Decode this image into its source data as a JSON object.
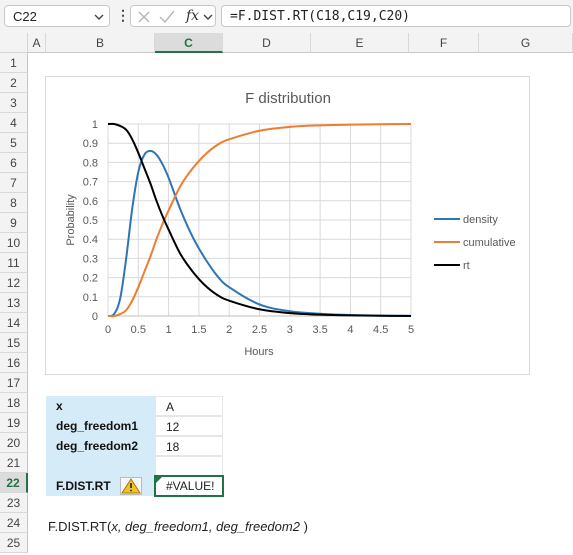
{
  "formula_bar": {
    "name_box": "C22",
    "fx_label": "fx",
    "formula": "=F.DIST.RT(C18,C19,C20)"
  },
  "columns": [
    "A",
    "B",
    "C",
    "D",
    "E",
    "F",
    "G"
  ],
  "rows": [
    "1",
    "2",
    "3",
    "4",
    "5",
    "6",
    "7",
    "8",
    "9",
    "10",
    "11",
    "12",
    "13",
    "14",
    "15",
    "16",
    "17",
    "18",
    "19",
    "20",
    "21",
    "22",
    "23",
    "24",
    "25"
  ],
  "selected_column": "C",
  "selected_row": "22",
  "table": {
    "x_label": "x",
    "x_value": "A",
    "df1_label": "deg_freedom1",
    "df1_value": "12",
    "df2_label": "deg_freedom2",
    "df2_value": "18",
    "result_label": "F.DIST.RT",
    "result_value": "#VALUE!"
  },
  "syntax": {
    "func": "F.DIST.RT(",
    "args": "x, deg_freedom1, deg_freedom2",
    "close": " )"
  },
  "colors": {
    "density": "#2E75B6",
    "cumulative": "#ED7D31",
    "rt": "#000000",
    "accent": "#217346",
    "label_fill": "#D6EBF8"
  },
  "chart_data": {
    "type": "line",
    "title": "F distribution",
    "xlabel": "Hours",
    "ylabel": "Probability",
    "xlim": [
      0,
      5
    ],
    "ylim": [
      0,
      1
    ],
    "x_ticks": [
      "0",
      "0.5",
      "1",
      "1.5",
      "2",
      "2.5",
      "3",
      "3.5",
      "4",
      "4.5",
      "5"
    ],
    "y_ticks": [
      "0",
      "0.1",
      "0.2",
      "0.3",
      "0.4",
      "0.5",
      "0.6",
      "0.7",
      "0.8",
      "0.9",
      "1"
    ],
    "grid": true,
    "legend_position": "right",
    "x": [
      0,
      0.1,
      0.2,
      0.3,
      0.4,
      0.5,
      0.6,
      0.7,
      0.8,
      0.9,
      1.0,
      1.2,
      1.4,
      1.6,
      1.8,
      2.0,
      2.5,
      3.0,
      3.5,
      4.0,
      4.5,
      5.0
    ],
    "series": [
      {
        "name": "density",
        "values": [
          0,
          0.01,
          0.09,
          0.3,
          0.56,
          0.75,
          0.84,
          0.86,
          0.84,
          0.79,
          0.72,
          0.55,
          0.41,
          0.3,
          0.21,
          0.15,
          0.06,
          0.025,
          0.012,
          0.005,
          0.002,
          0.001
        ]
      },
      {
        "name": "cumulative",
        "values": [
          0,
          0,
          0.01,
          0.03,
          0.08,
          0.15,
          0.23,
          0.31,
          0.4,
          0.48,
          0.55,
          0.68,
          0.77,
          0.84,
          0.89,
          0.92,
          0.965,
          0.985,
          0.993,
          0.997,
          0.999,
          1.0
        ]
      },
      {
        "name": "rt",
        "values": [
          1,
          1,
          0.99,
          0.97,
          0.92,
          0.85,
          0.77,
          0.69,
          0.6,
          0.52,
          0.45,
          0.32,
          0.23,
          0.16,
          0.11,
          0.08,
          0.035,
          0.015,
          0.007,
          0.003,
          0.001,
          0.0
        ]
      }
    ]
  }
}
